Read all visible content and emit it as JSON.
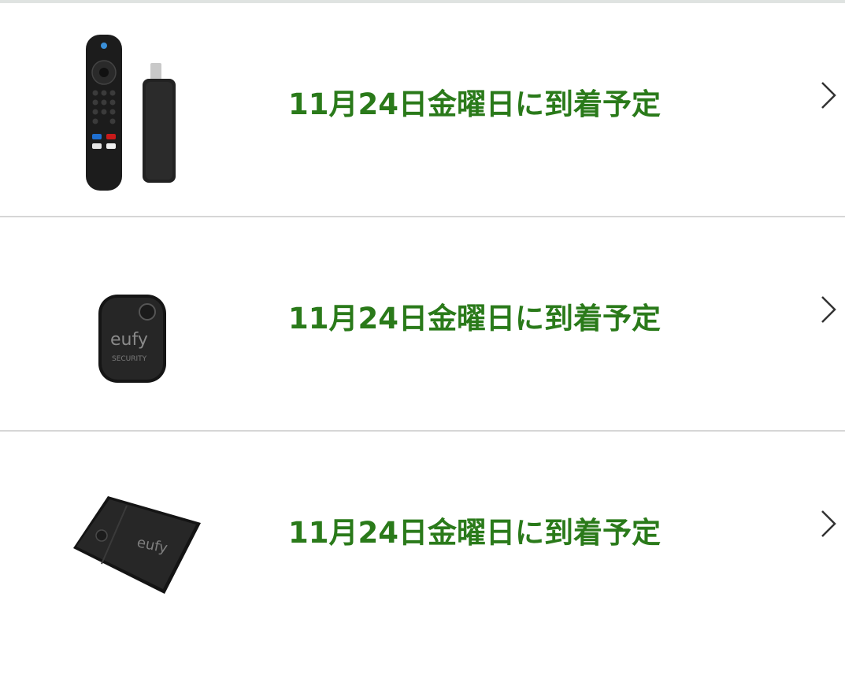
{
  "items": [
    {
      "product_icon": "fire-tv-stick-remote-icon",
      "delivery_text": "11月24日金曜日に到着予定",
      "chevron_icon": "chevron-right-icon"
    },
    {
      "product_icon": "eufy-security-tag-icon",
      "delivery_text": "11月24日金曜日に到着予定",
      "chevron_icon": "chevron-right-icon"
    },
    {
      "product_icon": "eufy-security-card-icon",
      "delivery_text": "11月24日金曜日に到着予定",
      "chevron_icon": "chevron-right-icon"
    }
  ],
  "colors": {
    "delivery_text": "#2a7a1a",
    "divider": "#d6d6d6",
    "top_strip": "#dfe3e1"
  }
}
